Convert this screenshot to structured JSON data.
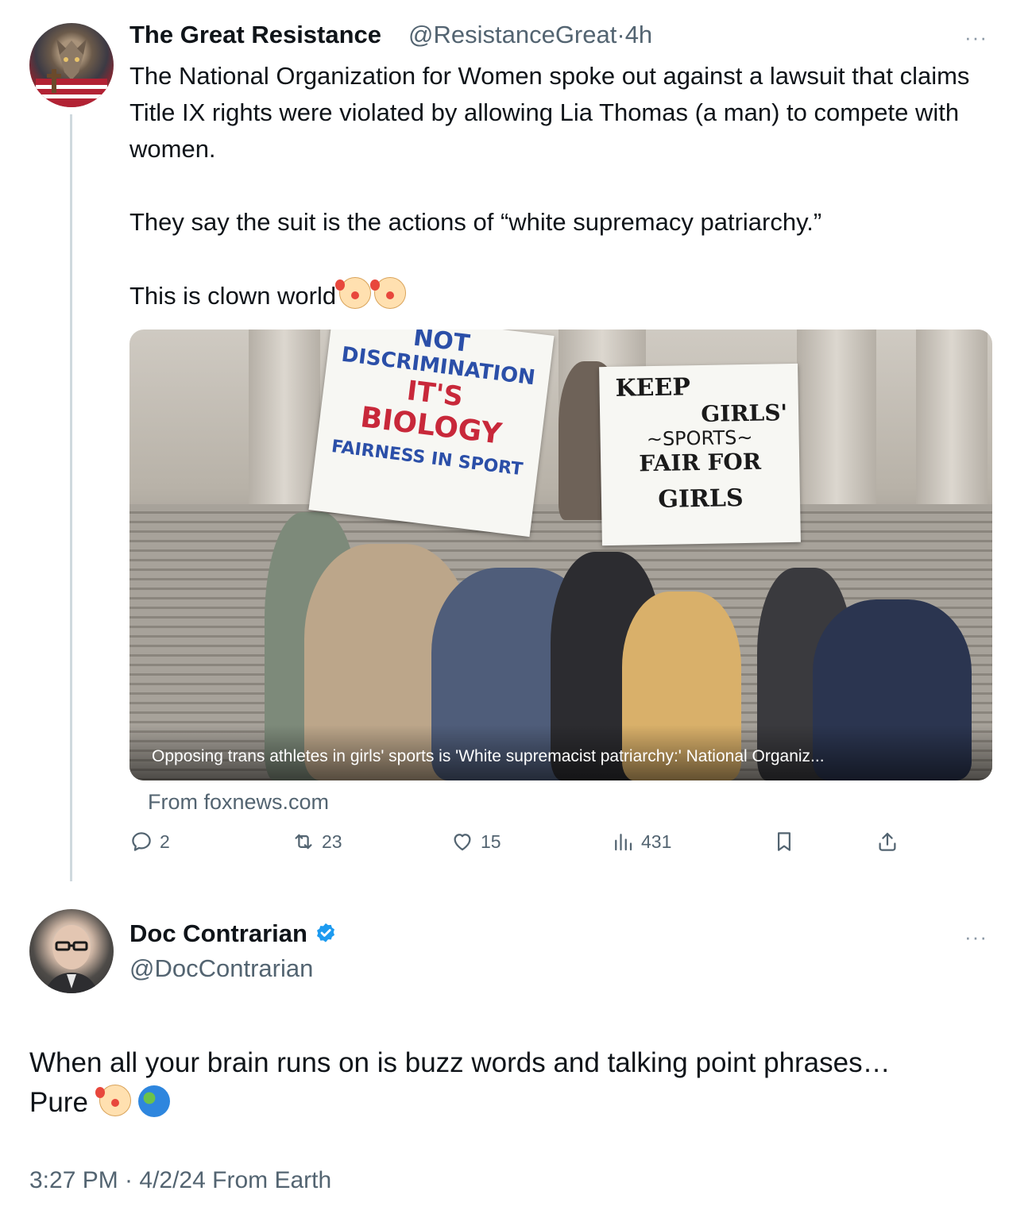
{
  "tweet1": {
    "display_name": "The Great Resistance",
    "handle": "@ResistanceGreat",
    "separator": "·",
    "time": "4h",
    "more_label": "···",
    "paragraphs": [
      "The National Organization for Women spoke out against a lawsuit that claims Title IX rights were violated by allowing Lia Thomas (a man) to compete with women.",
      "They say the suit is the actions of “white supremacy patriarchy.”",
      "This is clown world"
    ],
    "emoji_after_last": [
      "clown-face",
      "clown-face"
    ],
    "card": {
      "signs": {
        "left": [
          "NOT",
          "DISCRIMINATION",
          "IT'S",
          "BIOLOGY",
          "FAIRNESS IN SPORT"
        ],
        "right": [
          "KEEP",
          "GIRLS'",
          "~SPORTS~",
          "FAIR FOR",
          "GIRLS"
        ]
      },
      "caption": "Opposing trans athletes in girls' sports is 'White supremacist patriarchy:' National Organiz...",
      "source": "From foxnews.com"
    },
    "actions": {
      "replies": "2",
      "reposts": "23",
      "likes": "15",
      "views": "431"
    }
  },
  "tweet2": {
    "display_name": "Doc Contrarian",
    "verified": true,
    "handle": "@DocContrarian",
    "more_label": "···",
    "line1": "When all your brain runs on is buzz words and talking point phrases…",
    "line2": "Pure",
    "emoji_after_line2": [
      "clown-face",
      "globe-americas"
    ],
    "meta": "3:27 PM · 4/2/24 From Earth"
  },
  "colors": {
    "text": "#0f1419",
    "secondary": "#536471",
    "verified_blue": "#1d9bf0",
    "thread_line": "#cfd9de"
  }
}
